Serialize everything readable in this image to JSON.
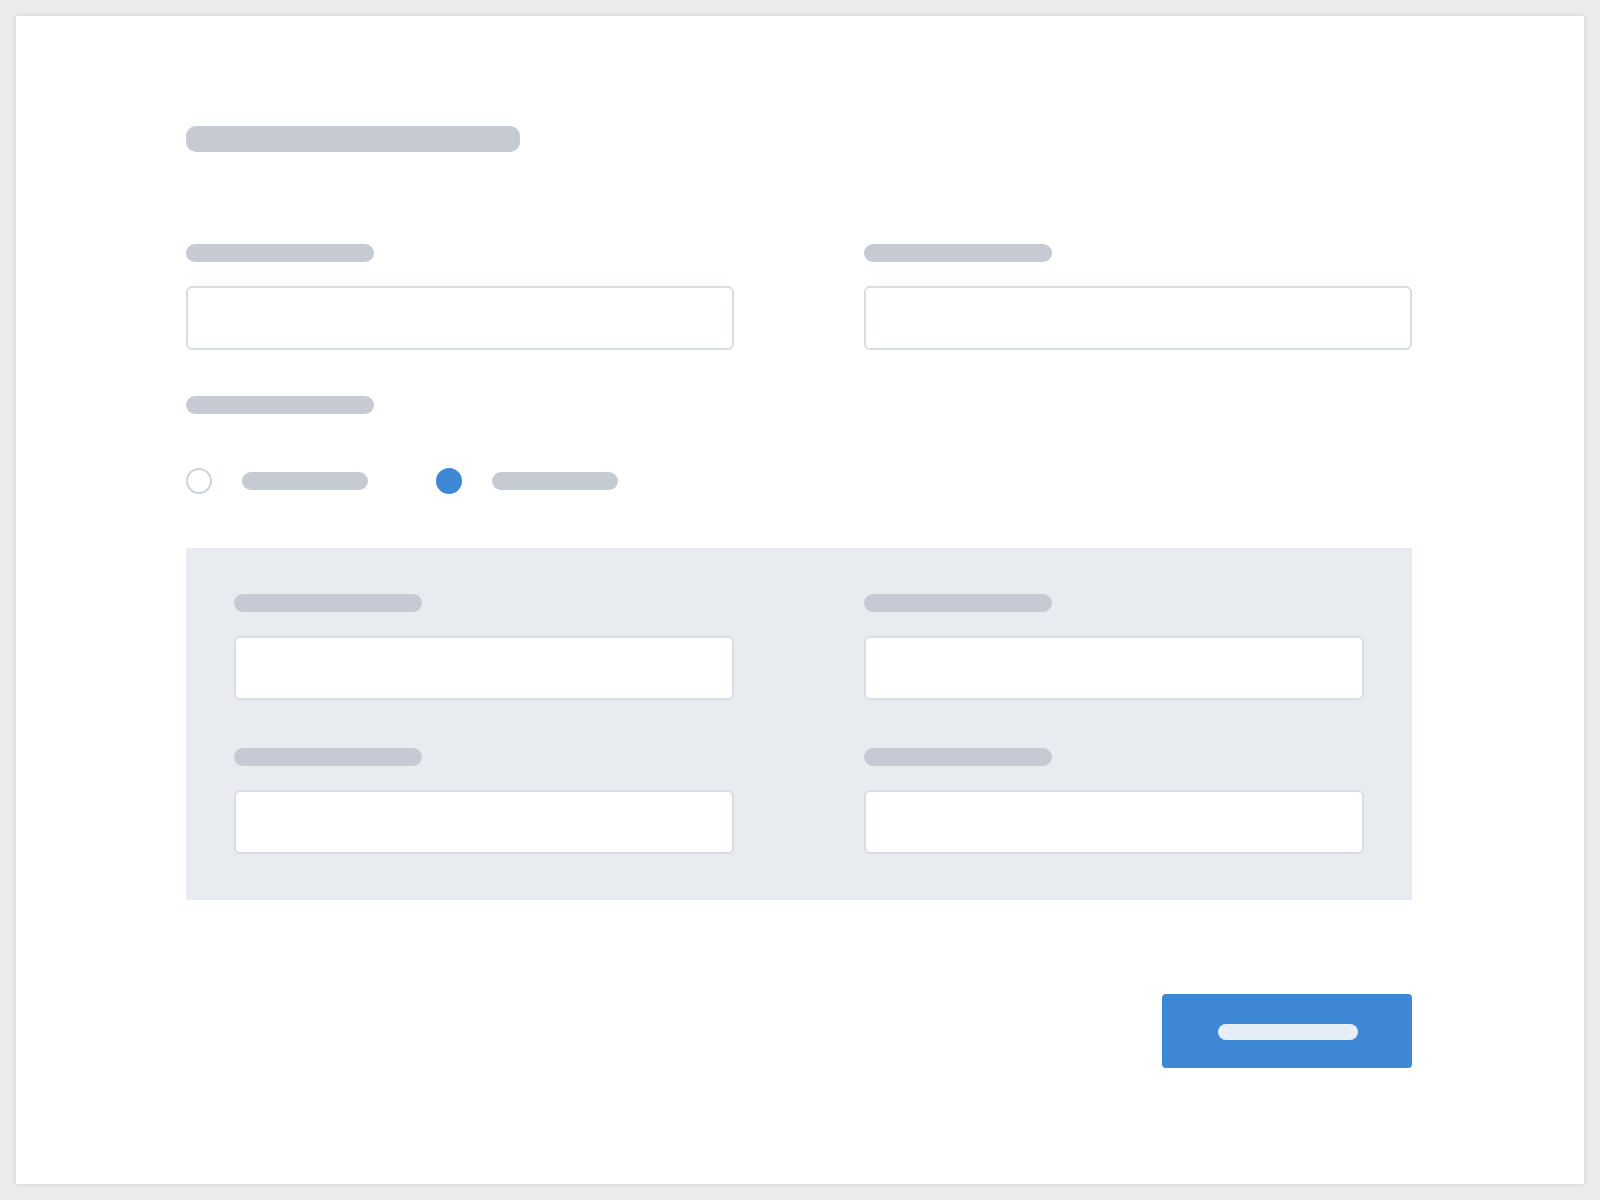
{
  "heading": {
    "kind": "skeleton"
  },
  "fields": [
    {
      "kind": "text"
    },
    {
      "kind": "text"
    }
  ],
  "choice": {
    "kind": "radio",
    "options": [
      {
        "selected": false
      },
      {
        "selected": true
      }
    ]
  },
  "panel": {
    "fields": [
      {
        "kind": "text"
      },
      {
        "kind": "text"
      },
      {
        "kind": "text"
      },
      {
        "kind": "text"
      }
    ]
  },
  "button": {
    "kind": "primary"
  }
}
